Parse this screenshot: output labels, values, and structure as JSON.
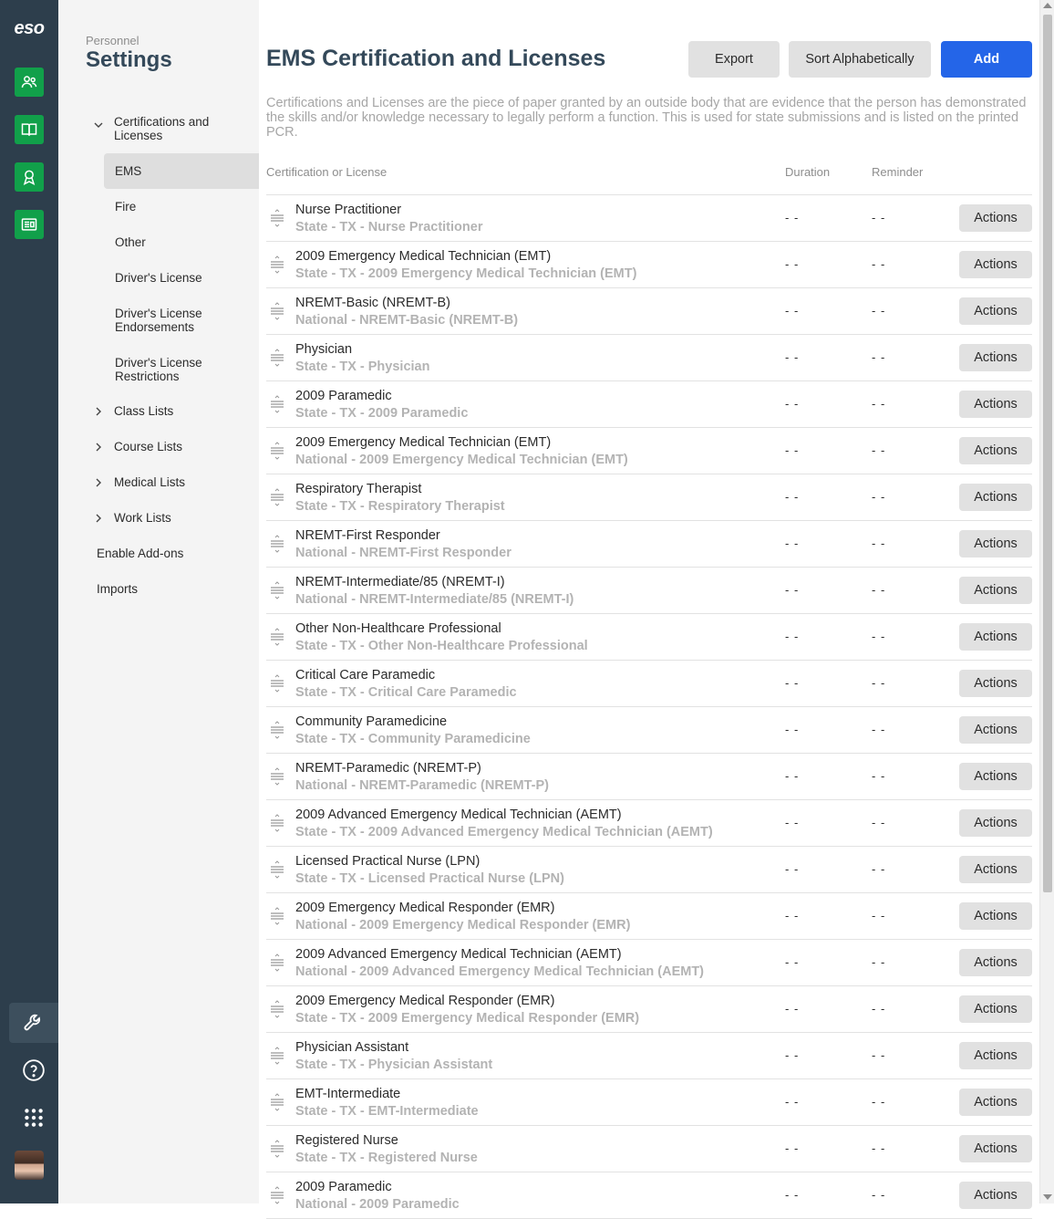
{
  "rail": {
    "logo": "eso",
    "apps": [
      "people-icon",
      "book-icon",
      "award-icon",
      "newspaper-icon"
    ],
    "bottom": [
      "wrench-icon",
      "help-icon",
      "apps-grid-icon"
    ]
  },
  "sidebar": {
    "crumb": "Personnel",
    "title": "Settings",
    "cert_group": "Certifications and Licenses",
    "cert_items": [
      "EMS",
      "Fire",
      "Other",
      "Driver's License",
      "Driver's License Endorsements",
      "Driver's License Restrictions"
    ],
    "groups": [
      "Class Lists",
      "Course Lists",
      "Medical Lists",
      "Work Lists"
    ],
    "plain": [
      "Enable Add-ons",
      "Imports"
    ]
  },
  "main": {
    "title": "EMS Certification and Licenses",
    "export_label": "Export",
    "sort_label": "Sort Alphabetically",
    "add_label": "Add",
    "description": "Certifications and Licenses are the piece of paper granted by an outside body that are evidence that the person has demonstrated the skills and/or knowledge necessary to legally perform a function. This is used for state submissions and is listed on the printed PCR.",
    "columns": {
      "name": "Certification or License",
      "duration": "Duration",
      "reminder": "Reminder"
    },
    "actions_label": "Actions",
    "rows": [
      {
        "name": "Nurse Practitioner",
        "sub": "State - TX - Nurse Practitioner",
        "duration": "- -",
        "reminder": "- -"
      },
      {
        "name": "2009 Emergency Medical Technician (EMT)",
        "sub": "State - TX - 2009 Emergency Medical Technician (EMT)",
        "duration": "- -",
        "reminder": "- -"
      },
      {
        "name": "NREMT-Basic (NREMT-B)",
        "sub": "National - NREMT-Basic (NREMT-B)",
        "duration": "- -",
        "reminder": "- -"
      },
      {
        "name": "Physician",
        "sub": "State - TX - Physician",
        "duration": "- -",
        "reminder": "- -"
      },
      {
        "name": "2009 Paramedic",
        "sub": "State - TX - 2009 Paramedic",
        "duration": "- -",
        "reminder": "- -"
      },
      {
        "name": "2009 Emergency Medical Technician (EMT)",
        "sub": "National - 2009 Emergency Medical Technician (EMT)",
        "duration": "- -",
        "reminder": "- -"
      },
      {
        "name": "Respiratory Therapist",
        "sub": "State - TX - Respiratory Therapist",
        "duration": "- -",
        "reminder": "- -"
      },
      {
        "name": "NREMT-First Responder",
        "sub": "National - NREMT-First Responder",
        "duration": "- -",
        "reminder": "- -"
      },
      {
        "name": "NREMT-Intermediate/85 (NREMT-I)",
        "sub": "National - NREMT-Intermediate/85 (NREMT-I)",
        "duration": "- -",
        "reminder": "- -"
      },
      {
        "name": "Other Non-Healthcare Professional",
        "sub": "State - TX - Other Non-Healthcare Professional",
        "duration": "- -",
        "reminder": "- -"
      },
      {
        "name": "Critical Care Paramedic",
        "sub": "State - TX - Critical Care Paramedic",
        "duration": "- -",
        "reminder": "- -"
      },
      {
        "name": "Community Paramedicine",
        "sub": "State - TX - Community Paramedicine",
        "duration": "- -",
        "reminder": "- -"
      },
      {
        "name": "NREMT-Paramedic (NREMT-P)",
        "sub": "National - NREMT-Paramedic (NREMT-P)",
        "duration": "- -",
        "reminder": "- -"
      },
      {
        "name": "2009 Advanced Emergency Medical Technician (AEMT)",
        "sub": "State - TX - 2009 Advanced Emergency Medical Technician (AEMT)",
        "duration": "- -",
        "reminder": "- -"
      },
      {
        "name": "Licensed Practical Nurse (LPN)",
        "sub": "State - TX - Licensed Practical Nurse (LPN)",
        "duration": "- -",
        "reminder": "- -"
      },
      {
        "name": "2009 Emergency Medical Responder (EMR)",
        "sub": "National - 2009 Emergency Medical Responder (EMR)",
        "duration": "- -",
        "reminder": "- -"
      },
      {
        "name": "2009 Advanced Emergency Medical Technician (AEMT)",
        "sub": "National - 2009 Advanced Emergency Medical Technician (AEMT)",
        "duration": "- -",
        "reminder": "- -"
      },
      {
        "name": "2009 Emergency Medical Responder (EMR)",
        "sub": "State - TX - 2009 Emergency Medical Responder (EMR)",
        "duration": "- -",
        "reminder": "- -"
      },
      {
        "name": "Physician Assistant",
        "sub": "State - TX - Physician Assistant",
        "duration": "- -",
        "reminder": "- -"
      },
      {
        "name": "EMT-Intermediate",
        "sub": "State - TX - EMT-Intermediate",
        "duration": "- -",
        "reminder": "- -"
      },
      {
        "name": "Registered Nurse",
        "sub": "State - TX - Registered Nurse",
        "duration": "- -",
        "reminder": "- -"
      },
      {
        "name": "2009 Paramedic",
        "sub": "National - 2009 Paramedic",
        "duration": "- -",
        "reminder": "- -"
      }
    ]
  },
  "colors": {
    "rail": "#2d3e4c",
    "app_green": "#11a04a",
    "primary_blue": "#2465e8",
    "title_slate": "#34495a"
  }
}
